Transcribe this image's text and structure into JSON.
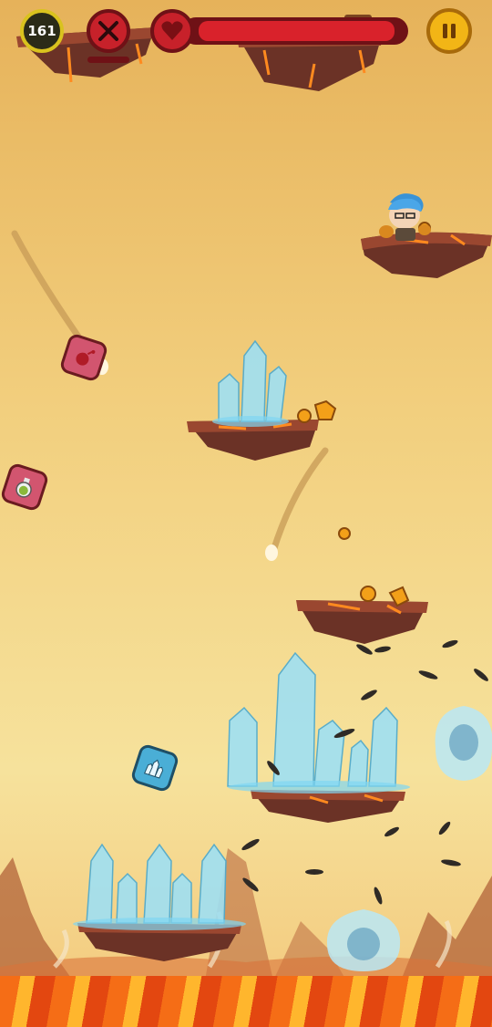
{
  "hud": {
    "score": "161",
    "health_fraction": 0.97
  },
  "icons": {
    "weapon": "crossed-swords-icon",
    "health": "heart-icon",
    "pause": "pause-icon",
    "item_bomb": "bomb-icon",
    "item_potion": "potion-icon",
    "item_crystal": "crystal-icon"
  },
  "colors": {
    "score_ring": "#d9c21e",
    "health_fill": "#d9222b",
    "pause_button": "#f2b516",
    "lava": "#f56d16",
    "crystal": "#8fd6ef"
  }
}
